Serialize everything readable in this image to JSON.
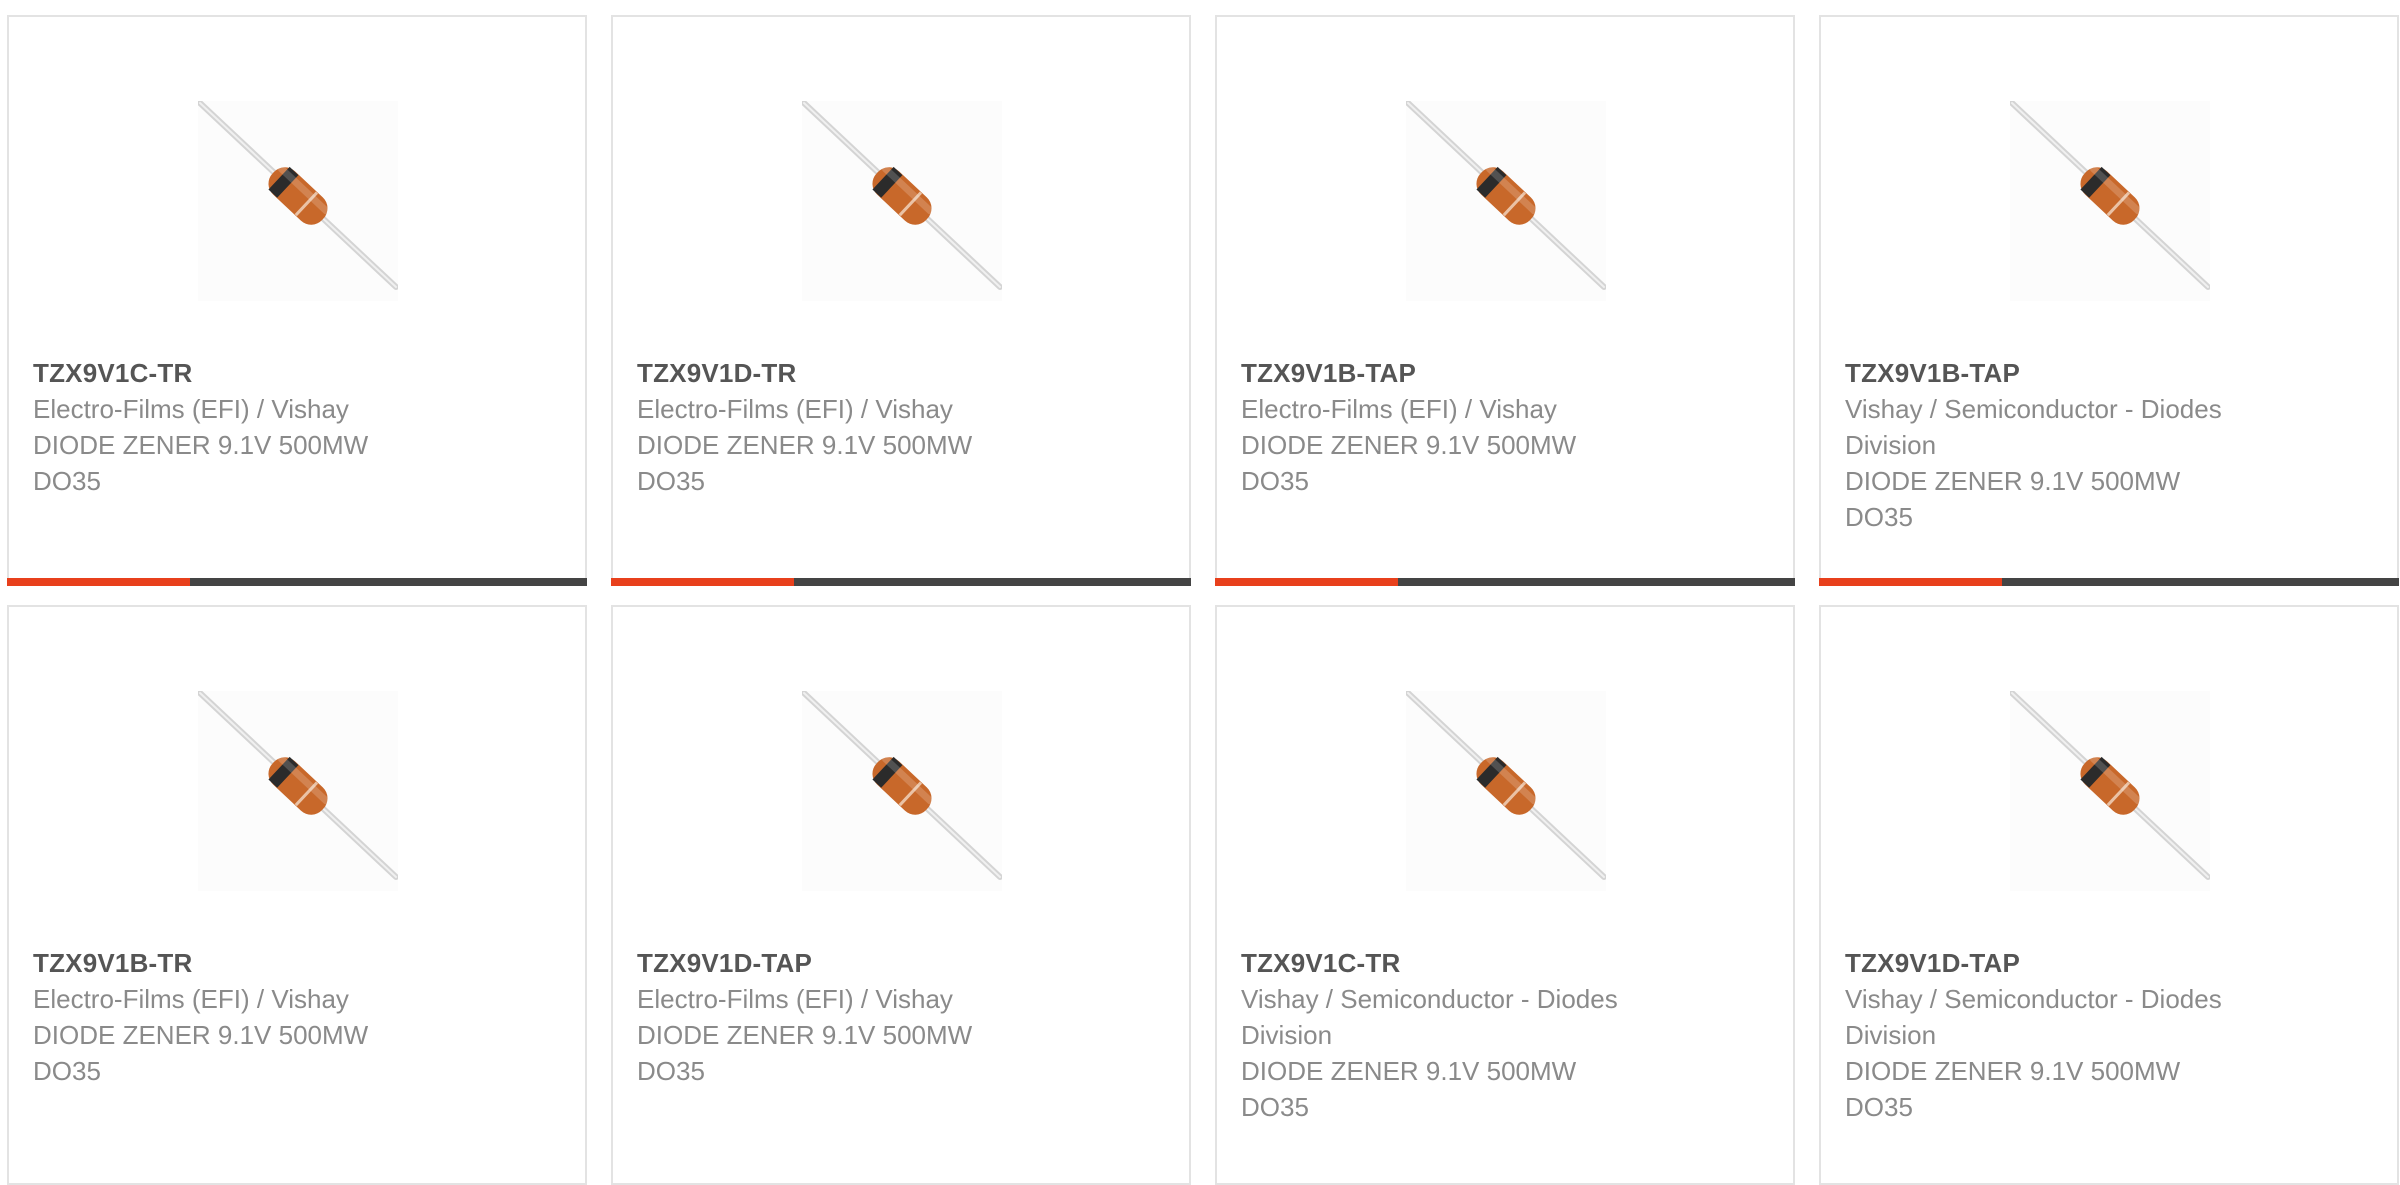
{
  "colors": {
    "accent": "#e8401c",
    "bar": "#444444",
    "part_text": "#555555",
    "meta_text": "#8a8a8a",
    "card_border": "#e3e3e3",
    "diode_body": "#c8682a",
    "diode_band": "#2b2b2b"
  },
  "products": [
    {
      "part": "TZX9V1C-TR",
      "manufacturer": "Electro-Films (EFI) / Vishay",
      "desc_1": "DIODE ZENER 9.1V 500MW",
      "desc_2": "DO35",
      "image_icon": "diode-axial-icon"
    },
    {
      "part": "TZX9V1D-TR",
      "manufacturer": "Electro-Films (EFI) / Vishay",
      "desc_1": "DIODE ZENER 9.1V 500MW",
      "desc_2": "DO35",
      "image_icon": "diode-axial-icon"
    },
    {
      "part": "TZX9V1B-TAP",
      "manufacturer": "Electro-Films (EFI) / Vishay",
      "desc_1": "DIODE ZENER 9.1V 500MW",
      "desc_2": "DO35",
      "image_icon": "diode-axial-icon"
    },
    {
      "part": "TZX9V1B-TAP",
      "manufacturer_1": "Vishay / Semiconductor - Diodes",
      "manufacturer_2": "Division",
      "desc_1": "DIODE ZENER 9.1V 500MW",
      "desc_2": "DO35",
      "image_icon": "diode-axial-icon"
    },
    {
      "part": "TZX9V1B-TR",
      "manufacturer": "Electro-Films (EFI) / Vishay",
      "desc_1": "DIODE ZENER 9.1V 500MW",
      "desc_2": "DO35",
      "image_icon": "diode-axial-icon"
    },
    {
      "part": "TZX9V1D-TAP",
      "manufacturer": "Electro-Films (EFI) / Vishay",
      "desc_1": "DIODE ZENER 9.1V 500MW",
      "desc_2": "DO35",
      "image_icon": "diode-axial-icon"
    },
    {
      "part": "TZX9V1C-TR",
      "manufacturer_1": "Vishay / Semiconductor - Diodes",
      "manufacturer_2": "Division",
      "desc_1": "DIODE ZENER 9.1V 500MW",
      "desc_2": "DO35",
      "image_icon": "diode-axial-icon"
    },
    {
      "part": "TZX9V1D-TAP",
      "manufacturer_1": "Vishay / Semiconductor - Diodes",
      "manufacturer_2": "Division",
      "desc_1": "DIODE ZENER 9.1V 500MW",
      "desc_2": "DO35",
      "image_icon": "diode-axial-icon"
    }
  ]
}
